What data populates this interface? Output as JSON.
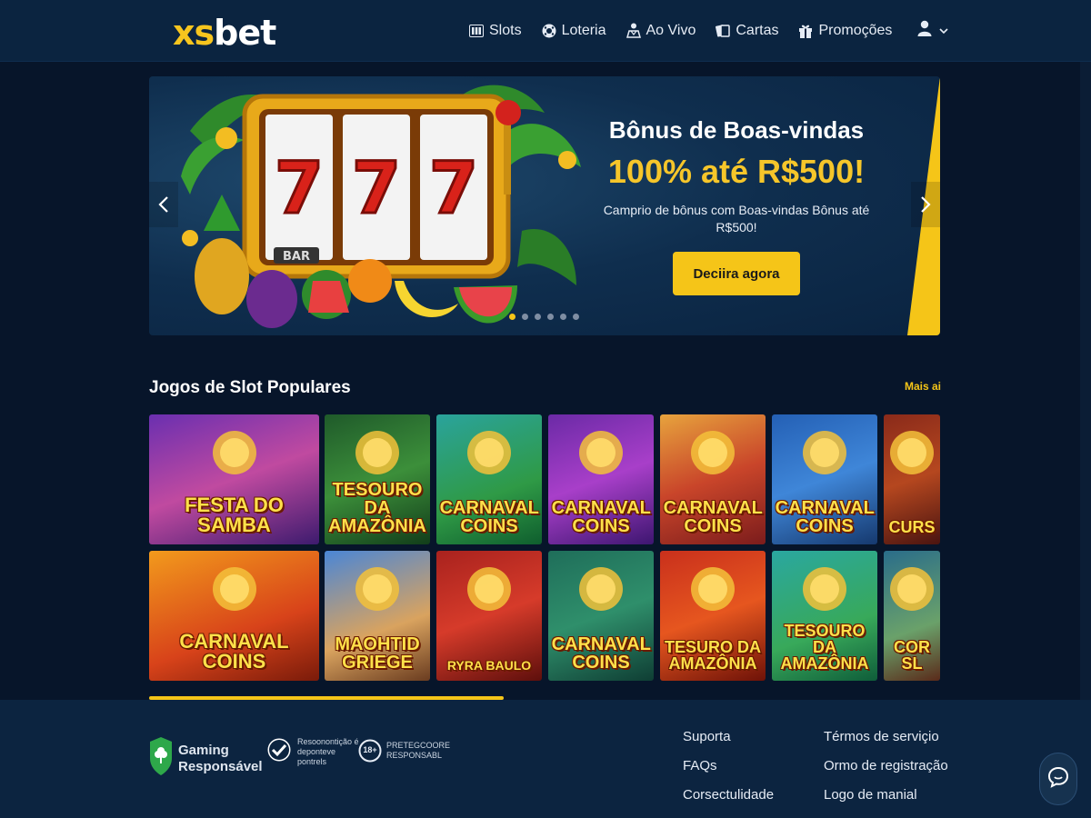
{
  "header": {
    "logo_xs": "xs",
    "logo_bet": "bet",
    "nav": [
      {
        "label": "Slots",
        "icon": "slot-machine-icon"
      },
      {
        "label": "Loteria",
        "icon": "lottery-ball-icon"
      },
      {
        "label": "Ao Vivo",
        "icon": "live-dealer-icon"
      },
      {
        "label": "Cartas",
        "icon": "cards-icon"
      },
      {
        "label": "Promoções",
        "icon": "gift-icon"
      }
    ],
    "user_icon": "user-icon",
    "user_chevron_icon": "chevron-down-icon"
  },
  "banner": {
    "title": "Bônus de Boas-vindas",
    "highlight": "100% até R$500!",
    "description": "Camprio de bônus com Boas-vindas Bônus até R$500!",
    "cta": "Deciira agora",
    "reel_symbols": [
      "7",
      "7",
      "7"
    ],
    "reel_bar": "BAR",
    "slide_count": 6,
    "active_slide": 1,
    "accent_color": "#f5c518"
  },
  "section": {
    "title": "Jogos de Slot Populares",
    "more": "Mais aic"
  },
  "games_row1": [
    {
      "name": "Festa do Samba"
    },
    {
      "name": "Tesouro da Amazônia"
    },
    {
      "name": "Carnaval Coins"
    },
    {
      "name": "Carnaval Coins"
    },
    {
      "name": "Carnaval Coins"
    },
    {
      "name": "Carnaval Coins"
    },
    {
      "name": "Curs"
    }
  ],
  "games_row2": [
    {
      "name": "Carnaval Coins"
    },
    {
      "name": "Maohtid Griege"
    },
    {
      "name": "Ryra Baulo"
    },
    {
      "name": "Carnaval Coins"
    },
    {
      "name": "Tesuro da Amazônia"
    },
    {
      "name": "Tesouro da Amazônia"
    },
    {
      "name": "Cor Sl"
    }
  ],
  "footer": {
    "gaming_line1": "Gaming",
    "gaming_line2": "Responsável",
    "check_text": "Resoonontição é deponteve pontrels",
    "age_badge": "18+",
    "age_text_line1": "PRETEGCOORE",
    "age_text_line2": "RESPONSABL",
    "col1": [
      "Suporta",
      "FAQs",
      "Corsectulidade"
    ],
    "col2": [
      "Térmos de serviçio",
      "Ormo de registração",
      "Logo de manial"
    ]
  },
  "chat_icon": "chat-bubble-icon"
}
